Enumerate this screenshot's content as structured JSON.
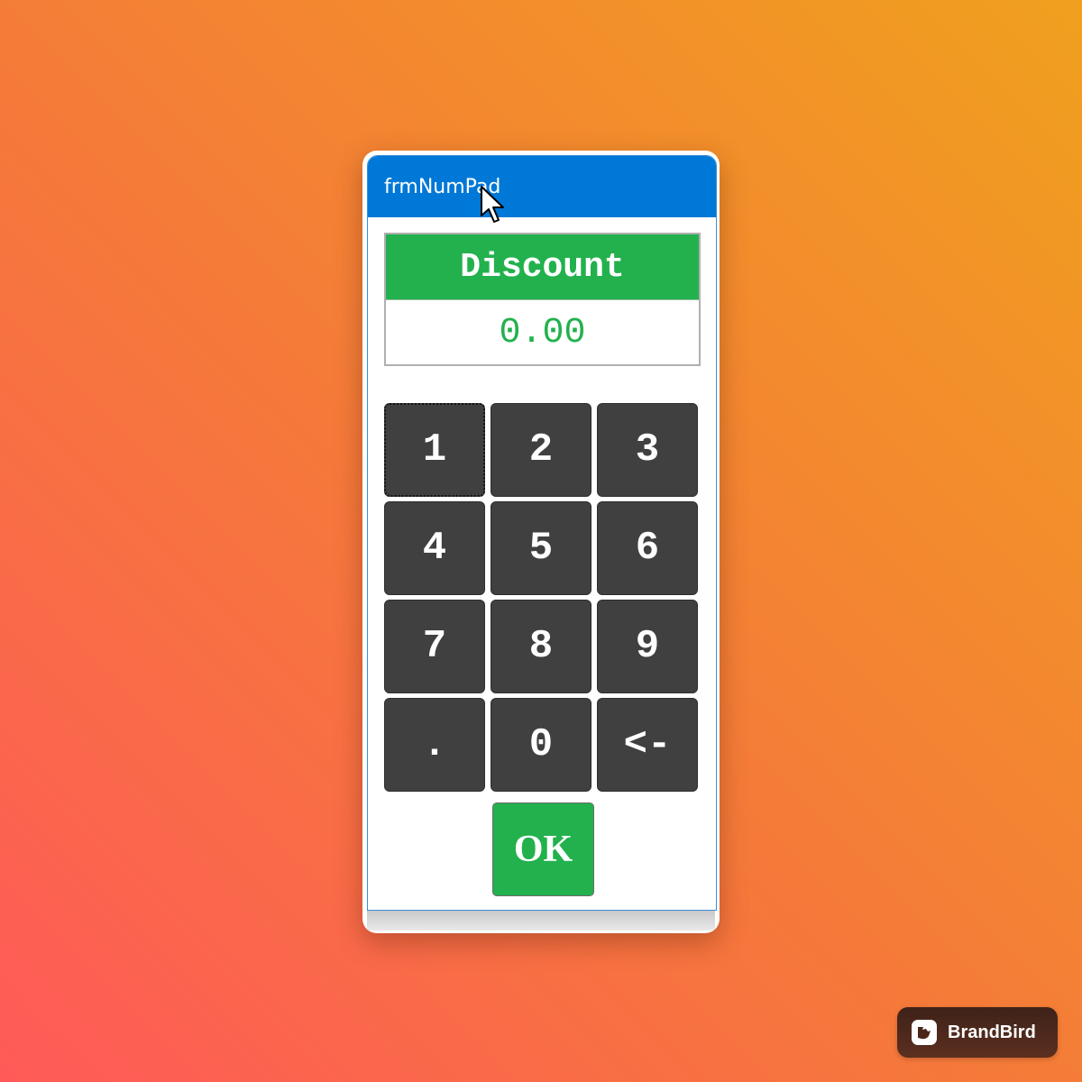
{
  "window": {
    "title": "frmNumPad"
  },
  "display": {
    "label": "Discount",
    "value": "0.00"
  },
  "keypad": {
    "keys": [
      "1",
      "2",
      "3",
      "4",
      "5",
      "6",
      "7",
      "8",
      "9",
      ".",
      "0",
      "<-"
    ],
    "focused_key": "1"
  },
  "ok_button": {
    "label": "OK"
  },
  "watermark": {
    "text": "BrandBird",
    "icon": "brandbird-logo-icon"
  },
  "colors": {
    "titlebar": "#0078d7",
    "accent_green": "#23b14d",
    "key_background": "#404040"
  }
}
